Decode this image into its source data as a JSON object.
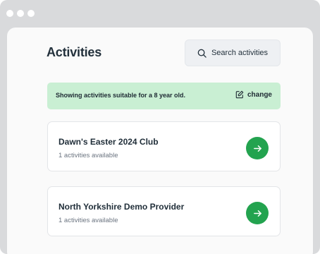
{
  "window": {
    "traffic_lights": [
      "dot",
      "dot",
      "dot"
    ]
  },
  "header": {
    "title": "Activities",
    "search_label": "Search activities",
    "search_icon": "search-icon"
  },
  "banner": {
    "text": "Showing activities suitable for a 8 year old.",
    "change_label": "change",
    "change_icon": "edit-icon"
  },
  "providers": [
    {
      "name": "Dawn's Easter 2024 Club",
      "count_text": "1 activities available"
    },
    {
      "name": "North Yorkshire Demo Provider",
      "count_text": "1 activities available"
    }
  ],
  "colors": {
    "accent": "#23a34f",
    "banner_bg": "#c9efd3",
    "window_frame": "#d9dadc"
  }
}
